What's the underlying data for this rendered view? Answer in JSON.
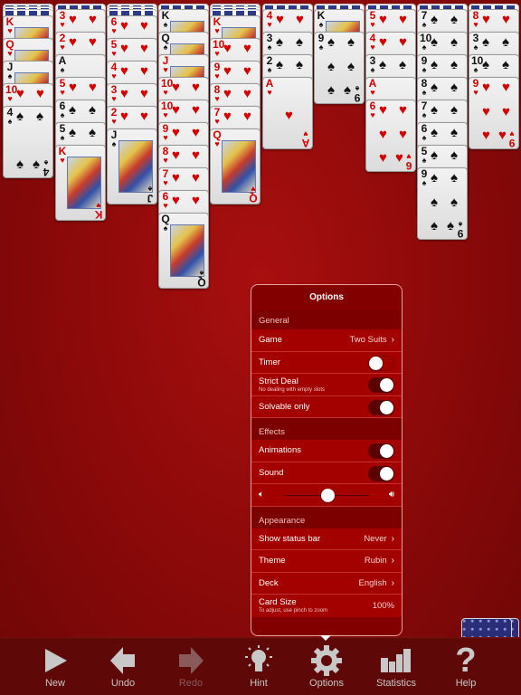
{
  "game": "Spider Solitaire",
  "tableau": [
    {
      "backs": 3,
      "cards": [
        [
          "K",
          "♥",
          "red",
          "face"
        ],
        [
          "Q",
          "♥",
          "red",
          "face"
        ],
        [
          "J",
          "♠",
          "blk",
          "face"
        ],
        [
          "10",
          "♥",
          "red"
        ],
        [
          "4",
          "♠",
          "blk"
        ]
      ]
    },
    {
      "backs": 1,
      "cards": [
        [
          "3",
          "♥",
          "red"
        ],
        [
          "2",
          "♥",
          "red"
        ],
        [
          "A",
          "♠",
          "blk"
        ],
        [
          "5",
          "♥",
          "red"
        ],
        [
          "6",
          "♠",
          "blk"
        ],
        [
          "5",
          "♠",
          "blk"
        ],
        [
          "K",
          "♥",
          "red",
          "face"
        ]
      ]
    },
    {
      "backs": 3,
      "cards": [
        [
          "6",
          "♥",
          "red"
        ],
        [
          "5",
          "♥",
          "red"
        ],
        [
          "4",
          "♥",
          "red"
        ],
        [
          "3",
          "♥",
          "red"
        ],
        [
          "2",
          "♥",
          "red"
        ],
        [
          "J",
          "♠",
          "blk",
          "face"
        ]
      ]
    },
    {
      "backs": 1,
      "cards": [
        [
          "K",
          "♠",
          "blk",
          "face"
        ],
        [
          "Q",
          "♠",
          "blk",
          "face"
        ],
        [
          "J",
          "♥",
          "red",
          "face"
        ],
        [
          "10",
          "♥",
          "red"
        ],
        [
          "10",
          "♥",
          "red"
        ],
        [
          "9",
          "♥",
          "red"
        ],
        [
          "8",
          "♥",
          "red"
        ],
        [
          "7",
          "♥",
          "red"
        ],
        [
          "6",
          "♥",
          "red"
        ],
        [
          "Q",
          "♠",
          "blk",
          "face"
        ]
      ]
    },
    {
      "backs": 3,
      "cards": [
        [
          "K",
          "♥",
          "red",
          "face"
        ],
        [
          "10",
          "♥",
          "red"
        ],
        [
          "9",
          "♥",
          "red"
        ],
        [
          "8",
          "♥",
          "red"
        ],
        [
          "7",
          "♥",
          "red"
        ],
        [
          "Q",
          "♥",
          "red",
          "face"
        ]
      ]
    },
    {
      "backs": 1,
      "cards": [
        [
          "4",
          "♥",
          "red"
        ],
        [
          "3",
          "♠",
          "blk"
        ],
        [
          "2",
          "♠",
          "blk"
        ],
        [
          "A",
          "♥",
          "red"
        ]
      ]
    },
    {
      "backs": 1,
      "cards": [
        [
          "K",
          "♠",
          "blk",
          "face"
        ],
        [
          "9",
          "♠",
          "blk"
        ]
      ]
    },
    {
      "backs": 1,
      "cards": [
        [
          "5",
          "♥",
          "red"
        ],
        [
          "4",
          "♥",
          "red"
        ],
        [
          "3",
          "♠",
          "blk"
        ],
        [
          "A",
          "♥",
          "red"
        ],
        [
          "6",
          "♥",
          "red"
        ]
      ]
    },
    {
      "backs": 1,
      "cards": [
        [
          "7",
          "♠",
          "blk"
        ],
        [
          "10",
          "♠",
          "blk"
        ],
        [
          "9",
          "♠",
          "blk"
        ],
        [
          "8",
          "♠",
          "blk"
        ],
        [
          "7",
          "♠",
          "blk"
        ],
        [
          "6",
          "♠",
          "blk"
        ],
        [
          "5",
          "♠",
          "blk"
        ],
        [
          "9",
          "♠",
          "blk"
        ]
      ]
    },
    {
      "backs": 1,
      "cards": [
        [
          "8",
          "♥",
          "red"
        ],
        [
          "3",
          "♠",
          "blk"
        ],
        [
          "10",
          "♠",
          "blk"
        ],
        [
          "9",
          "♥",
          "red"
        ]
      ]
    }
  ],
  "options": {
    "title": "Options",
    "general": {
      "header": "General",
      "game_label": "Game",
      "game_value": "Two Suits",
      "timer_label": "Timer",
      "timer_on": false,
      "strict_label": "Strict Deal",
      "strict_sub": "No dealing with empty slots",
      "strict_on": true,
      "solvable_label": "Solvable only",
      "solvable_on": true
    },
    "effects": {
      "header": "Effects",
      "animations_label": "Animations",
      "animations_on": true,
      "sound_label": "Sound",
      "sound_on": true,
      "volume": 0.5
    },
    "appearance": {
      "header": "Appearance",
      "status_label": "Show status bar",
      "status_value": "Never",
      "theme_label": "Theme",
      "theme_value": "Rubin",
      "deck_label": "Deck",
      "deck_value": "English",
      "size_label": "Card Size",
      "size_sub": "To adjust, use pinch to zoom",
      "size_value": "100%"
    },
    "chevron": "›"
  },
  "toolbar": {
    "new": "New",
    "undo": "Undo",
    "redo": "Redo",
    "hint": "Hint",
    "options": "Options",
    "statistics": "Statistics",
    "help": "Help"
  },
  "colors": {
    "felt": "#8a0909",
    "popover": "#a30000",
    "accent_red": "#d40000"
  }
}
